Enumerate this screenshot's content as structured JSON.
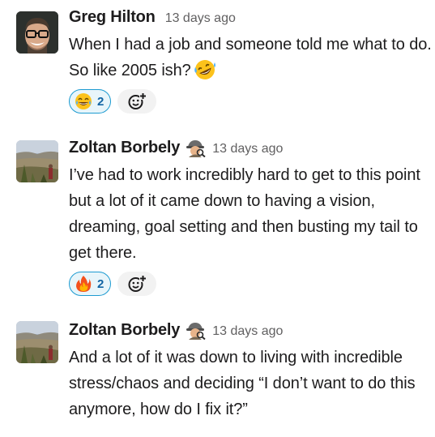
{
  "messages": [
    {
      "author": "Greg Hilton",
      "timestamp": "13 days ago",
      "text": "When I had a job and someone told me what to do.  So like 2005 ish?",
      "inline_emoji": "rolling-on-floor-laughing-icon",
      "status_icon": null,
      "reactions": [
        {
          "emoji": "joy-icon",
          "count": "2"
        }
      ]
    },
    {
      "author": "Zoltan Borbely",
      "timestamp": "13 days ago",
      "text": "I’ve had to work incredibly hard to get to this point but a lot of it came down to having a vision, dreaming, goal setting and then busting my tail to get there.",
      "status_icon": "detective-icon",
      "reactions": [
        {
          "emoji": "fire-icon",
          "count": "2"
        }
      ]
    },
    {
      "author": "Zoltan Borbely",
      "timestamp": "13 days ago",
      "text": "And a lot of it was down to living with incredible stress/chaos and deciding “I don’t want to do this anymore, how do I fix it?”",
      "status_icon": "detective-icon",
      "reactions": []
    }
  ],
  "colors": {
    "reaction_border": "#1d9bd1",
    "reaction_bg": "#e8f5fa",
    "reaction_count": "#1264a3",
    "timestamp": "#616061",
    "text": "#1d1c1d"
  }
}
